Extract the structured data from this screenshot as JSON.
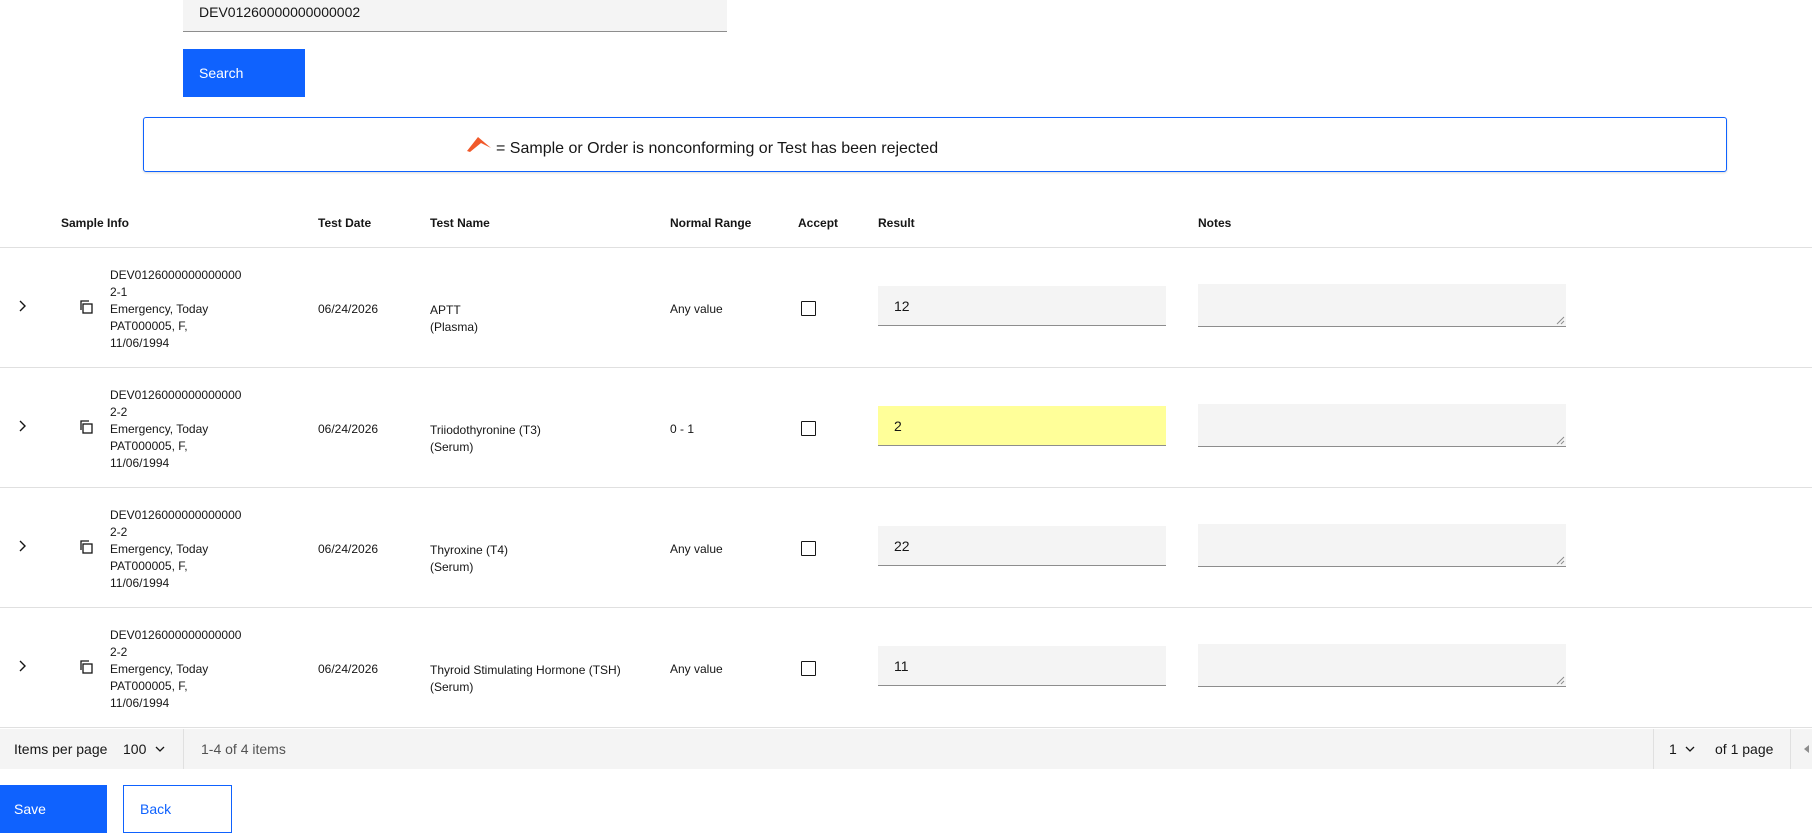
{
  "search": {
    "value": "DEV01260000000000002",
    "button_label": "Search"
  },
  "legend": {
    "text": "= Sample or Order is nonconforming or Test has been rejected",
    "icon": "nonconforming-flag-icon",
    "icon_color": "#f1592a"
  },
  "table": {
    "headers": {
      "sample_info": "Sample Info",
      "test_date": "Test Date",
      "test_name": "Test Name",
      "normal_range": "Normal Range",
      "accept": "Accept",
      "result": "Result",
      "notes": "Notes"
    },
    "rows": [
      {
        "sample_line1": "DEV0126000000000000",
        "sample_line2": "2-1",
        "sample_line3": "Emergency, Today",
        "sample_line4": "PAT000005, F,",
        "sample_line5": "11/06/1994",
        "test_date": "06/24/2026",
        "test_name": "APTT",
        "sample_type": "(Plasma)",
        "normal_range": "Any value",
        "accepted": false,
        "result": "12",
        "notes": ""
      },
      {
        "sample_line1": "DEV0126000000000000",
        "sample_line2": "2-2",
        "sample_line3": "Emergency, Today",
        "sample_line4": "PAT000005, F,",
        "sample_line5": "11/06/1994",
        "test_date": "06/24/2026",
        "test_name": "Triiodothyronine (T3)",
        "sample_type": "(Serum)",
        "normal_range": "0 - 1",
        "accepted": false,
        "result": "2",
        "result_highlight": "#ffff99",
        "notes": ""
      },
      {
        "sample_line1": "DEV0126000000000000",
        "sample_line2": "2-2",
        "sample_line3": "Emergency, Today",
        "sample_line4": "PAT000005, F,",
        "sample_line5": "11/06/1994",
        "test_date": "06/24/2026",
        "test_name": "Thyroxine (T4)",
        "sample_type": "(Serum)",
        "normal_range": "Any value",
        "accepted": false,
        "result": "22",
        "notes": ""
      },
      {
        "sample_line1": "DEV0126000000000000",
        "sample_line2": "2-2",
        "sample_line3": "Emergency, Today",
        "sample_line4": "PAT000005, F,",
        "sample_line5": "11/06/1994",
        "test_date": "06/24/2026",
        "test_name": "Thyroid Stimulating Hormone (TSH)",
        "sample_type": "(Serum)",
        "normal_range": "Any value",
        "accepted": false,
        "result": "11",
        "notes": ""
      }
    ]
  },
  "pagination": {
    "items_per_page_label": "Items per page",
    "items_per_page_value": "100",
    "range_text": "1-4 of 4 items",
    "page_value": "1",
    "of_pages": "of 1 page"
  },
  "actions": {
    "save_label": "Save",
    "back_label": "Back"
  },
  "colors": {
    "primary": "#0f62fe",
    "field_bg": "#f4f4f4",
    "flag": "#f1592a"
  }
}
